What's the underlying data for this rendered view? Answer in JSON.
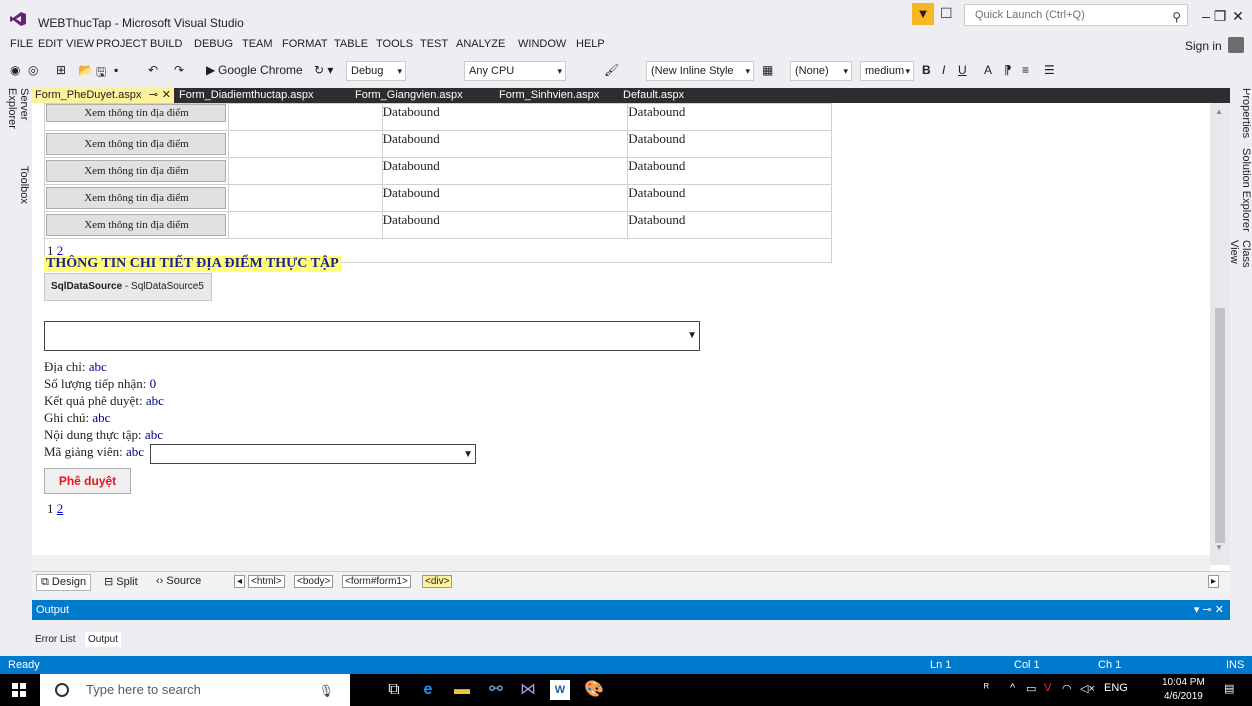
{
  "window": {
    "title": "WEBThucTap - Microsoft Visual Studio",
    "quick_launch_placeholder": "Quick Launch (Ctrl+Q)"
  },
  "menu": [
    "FILE",
    "EDIT",
    "VIEW",
    "PROJECT",
    "BUILD",
    "DEBUG",
    "TEAM",
    "FORMAT",
    "TABLE",
    "TOOLS",
    "TEST",
    "ANALYZE",
    "WINDOW",
    "HELP"
  ],
  "sign_in": "Sign in",
  "toolbar": {
    "browser": "Google Chrome",
    "config": "Debug",
    "platform": "Any CPU",
    "style": "(New Inline Style",
    "target": "(None)",
    "size": "medium",
    "bold": "B",
    "italic": "I",
    "underline": "U"
  },
  "side_left": [
    "Server Explorer",
    "Toolbox"
  ],
  "side_right": [
    "Properties",
    "Solution Explorer",
    "Class View"
  ],
  "tabs": [
    "Form_PheDuyet.aspx",
    "Form_Diadiemthuctap.aspx",
    "Form_Giangvien.aspx",
    "Form_Sinhvien.aspx",
    "Default.aspx"
  ],
  "grid": {
    "button_label": "Xem thông tin địa điểm",
    "rows": [
      {
        "c1": "Databound",
        "c2": "Databound"
      },
      {
        "c1": "Databound",
        "c2": "Databound"
      },
      {
        "c1": "Databound",
        "c2": "Databound"
      },
      {
        "c1": "Databound",
        "c2": "Databound"
      },
      {
        "c1": "Databound",
        "c2": "Databound"
      }
    ],
    "pager_current": "1",
    "pager_link": "2"
  },
  "detail": {
    "title": "THÔNG TIN CHI TIẾT ĐỊA ĐIỂM THỰC TẬP",
    "sqlds_type": "SqlDataSource",
    "sqlds_name": " - SqlDataSource5",
    "fields": [
      {
        "label": "Địa chỉ: ",
        "value": "abc"
      },
      {
        "label": "Số lượng tiếp nhận: ",
        "value": "0"
      },
      {
        "label": "Kết quả phê duyệt: ",
        "value": "abc"
      },
      {
        "label": "Ghi chú: ",
        "value": "abc"
      },
      {
        "label": "Nội dung thực tập: ",
        "value": "abc"
      }
    ],
    "gv_label": "Mã giảng viên: ",
    "gv_value": "abc",
    "approve_button": "Phê duyệt",
    "pager_current": "1",
    "pager_link": "2"
  },
  "views": {
    "design": "Design",
    "split": "Split",
    "source": "Source"
  },
  "breadcrumbs": [
    "<html>",
    "<body>",
    "<form#form1>",
    "<div>"
  ],
  "output": {
    "title": "Output",
    "tab_errors": "Error List",
    "tab_output": "Output"
  },
  "status": {
    "ready": "Ready",
    "ln": "Ln 1",
    "col": "Col 1",
    "ch": "Ch 1",
    "ins": "INS"
  },
  "taskbar": {
    "search_placeholder": "Type here to search",
    "lang": "ENG",
    "time": "10:04 PM",
    "date": "4/6/2019"
  },
  "colors": {
    "accent": "#007acc",
    "title_highlight": "#ffff7b",
    "approve_text": "#e8131a"
  }
}
